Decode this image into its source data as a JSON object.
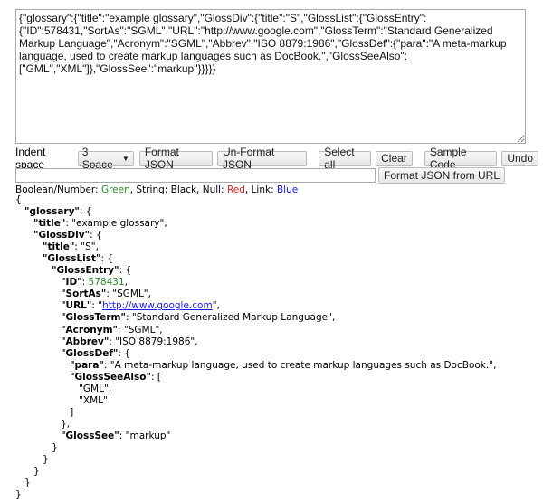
{
  "input": {
    "value": "{\"glossary\":{\"title\":\"example glossary\",\"GlossDiv\":{\"title\":\"S\",\"GlossList\":{\"GlossEntry\":{\"ID\":578431,\"SortAs\":\"SGML\",\"URL\":\"http://www.google.com\",\"GlossTerm\":\"Standard Generalized Markup Language\",\"Acronym\":\"SGML\",\"Abbrev\":\"ISO 8879:1986\",\"GlossDef\":{\"para\":\"A meta-markup language, used to create markup languages such as DocBook.\",\"GlossSeeAlso\":[\"GML\",\"XML\"]},\"GlossSee\":\"markup\"}}}}}"
  },
  "toolbar": {
    "indent_label": "Indent space",
    "indent_value": "3 Space",
    "format": "Format JSON",
    "unformat": "Un-Format JSON",
    "select_all": "Select all",
    "clear": "Clear",
    "sample": "Sample Code",
    "undo": "Undo"
  },
  "url": {
    "value": "",
    "button": "Format JSON from URL"
  },
  "legend": {
    "bn_label": "Boolean/Number: ",
    "bn_color": "Green",
    "s_label": ", String: Black, Null: ",
    "null_color": "Red",
    "link_label": ", Link: ",
    "link_color": "Blue"
  },
  "colors": {
    "number": "#2a8a2a",
    "null": "#e02020",
    "link": "#1a1aee"
  }
}
